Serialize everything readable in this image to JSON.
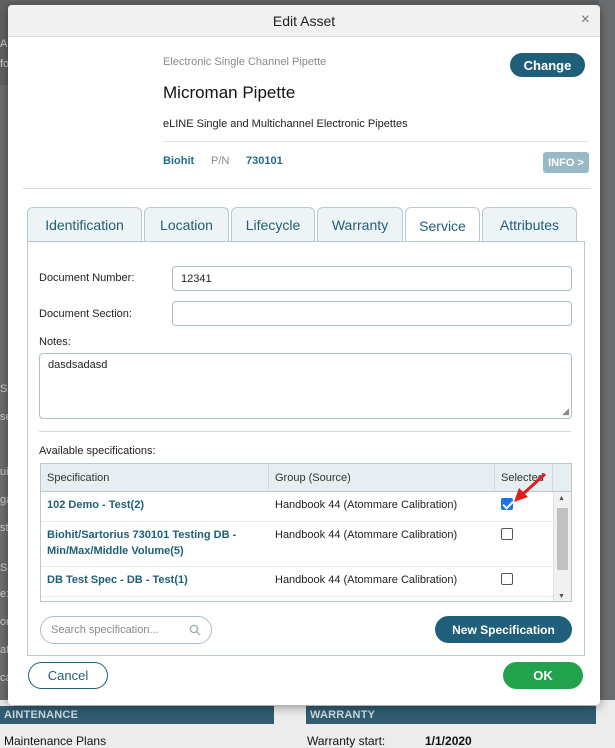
{
  "background": {
    "fragments": [
      "A",
      "fo",
      "SE",
      "se",
      "ui",
      "ga",
      "st",
      "SS",
      "e:",
      "or",
      "ati",
      "ca"
    ],
    "maintenance_label": "AINTENANCE",
    "warranty_label": "WARRANTY",
    "maintenance_plans_label": "Maintenance Plans",
    "warranty_start_label": "Warranty start:",
    "warranty_start_value": "1/1/2020"
  },
  "modal": {
    "title": "Edit Asset",
    "close_glyph": "×"
  },
  "asset": {
    "category": "Electronic Single Channel Pipette",
    "name": "Microman Pipette",
    "description": "eLINE Single and Multichannel Electronic Pipettes",
    "manufacturer": "Biohit",
    "pn_label": "P/N",
    "part_number": "730101",
    "change_label": "Change",
    "info_label": "INFO >"
  },
  "tabs": [
    {
      "label": "Identification"
    },
    {
      "label": "Location"
    },
    {
      "label": "Lifecycle"
    },
    {
      "label": "Warranty"
    },
    {
      "label": "Service"
    },
    {
      "label": "Attributes"
    }
  ],
  "active_tab": "Service",
  "service": {
    "document_number_label": "Document Number:",
    "document_number_value": "12341",
    "document_section_label": "Document Section:",
    "document_section_value": "",
    "notes_label": "Notes:",
    "notes_value": "dasdsadasd",
    "available_label": "Available specifications:",
    "table_headers": {
      "specification": "Specification",
      "group": "Group (Source)",
      "selected": "Selected"
    },
    "specs": [
      {
        "name": "102 Demo - Test(2)",
        "group": "Handbook 44 (Atommare Calibration)",
        "selected": true
      },
      {
        "name": "Biohit/Sartorius 730101 Testing DB - Min/Max/Middle Volume(5)",
        "group": "Handbook 44 (Atommare Calibration)",
        "selected": false
      },
      {
        "name": "DB Test Spec - DB - Test(1)",
        "group": "Handbook 44 (Atommare Calibration)",
        "selected": false
      }
    ],
    "search_placeholder": "Search specification...",
    "new_spec_label": "New Specification"
  },
  "footer": {
    "cancel_label": "Cancel",
    "ok_label": "OK"
  },
  "colors": {
    "primary": "#1f5f7a",
    "ok": "#23a24d",
    "arrow": "#e01e1e"
  }
}
